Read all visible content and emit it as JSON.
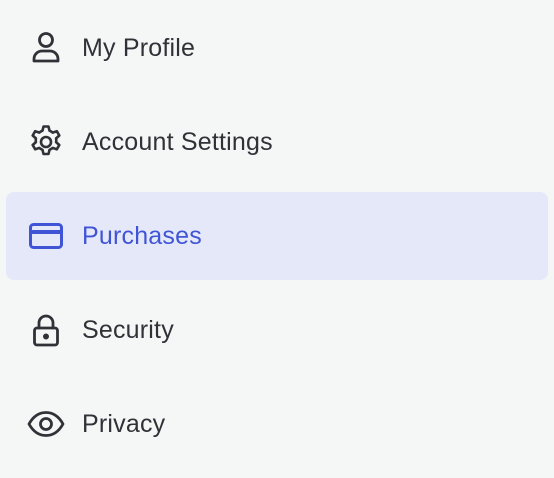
{
  "theme": {
    "background": "#f5f6f6",
    "text": "#2f3237",
    "active_background": "#e5e8f8",
    "active_accent": "#4054d6"
  },
  "menu": {
    "items": [
      {
        "label": "My Profile",
        "icon": "user-icon",
        "active": false
      },
      {
        "label": "Account Settings",
        "icon": "gear-icon",
        "active": false
      },
      {
        "label": "Purchases",
        "icon": "credit-card-icon",
        "active": true
      },
      {
        "label": "Security",
        "icon": "lock-icon",
        "active": false
      },
      {
        "label": "Privacy",
        "icon": "eye-icon",
        "active": false
      }
    ]
  }
}
